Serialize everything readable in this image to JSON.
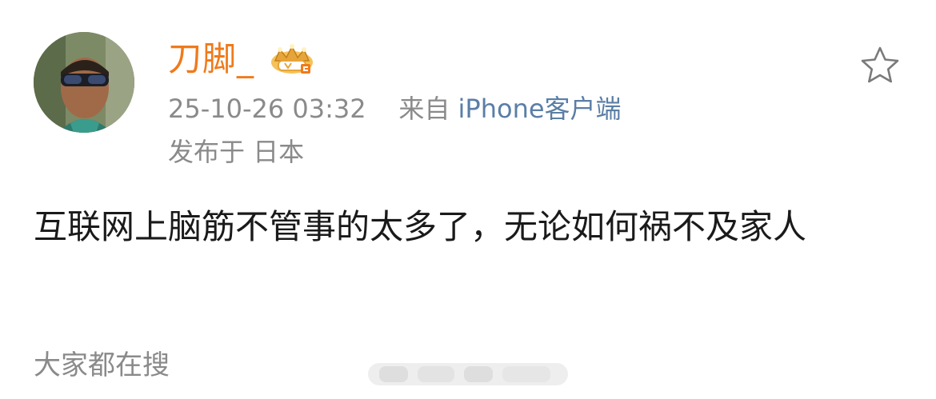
{
  "post": {
    "username": "刀脚_",
    "timestamp": "25-10-26 03:32",
    "source_prefix": "来自",
    "source_client": "iPhone客户端",
    "location": "发布于 日本",
    "content": "互联网上脑筋不管事的太多了，无论如何祸不及家人"
  },
  "footer": {
    "hot_search_label": "大家都在搜"
  },
  "icons": {
    "vip": "vip-crown-icon",
    "favorite": "star-outline-icon"
  },
  "colors": {
    "username": "#f07a1a",
    "meta": "#8a8a8a",
    "source_link": "#5b7ea6",
    "vip_gold": "#e6a53a"
  }
}
